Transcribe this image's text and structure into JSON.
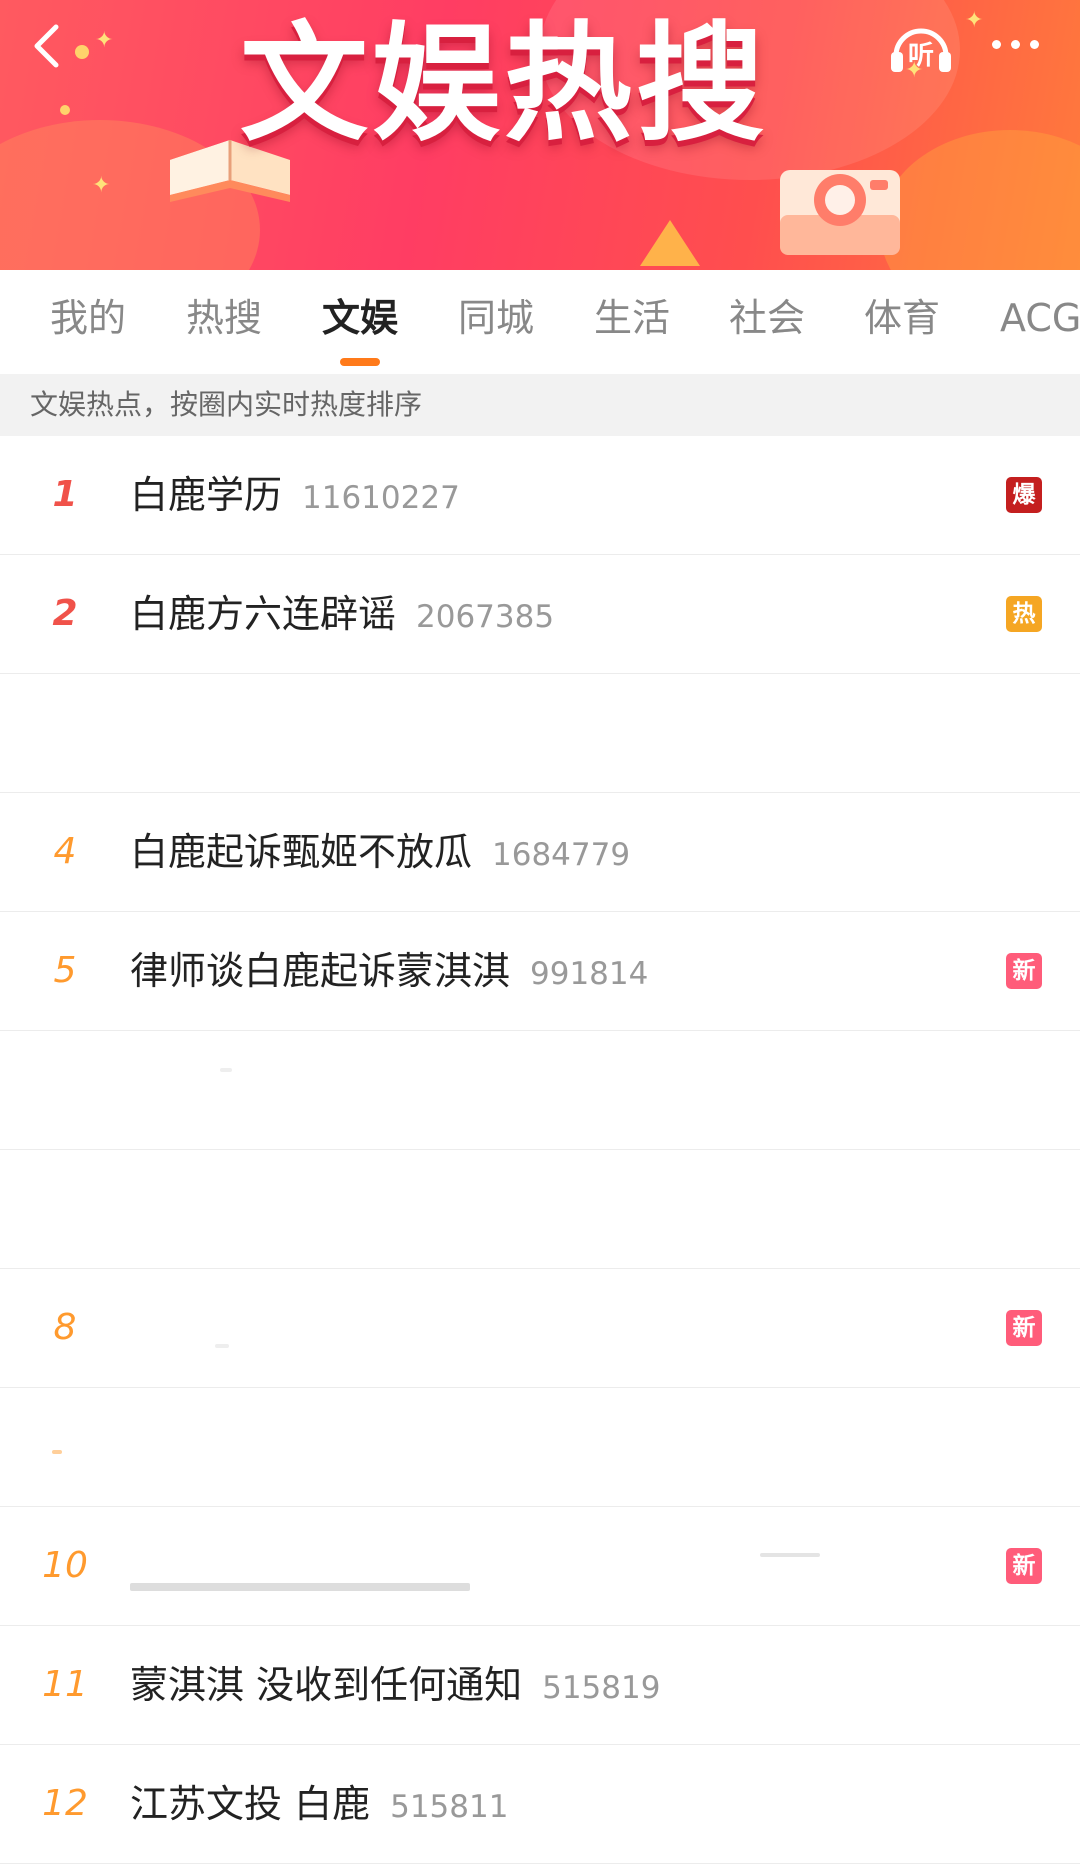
{
  "header": {
    "title": "文娱热搜",
    "listen_label": "听"
  },
  "tabs": [
    {
      "label": "我的",
      "active": false
    },
    {
      "label": "热搜",
      "active": false
    },
    {
      "label": "文娱",
      "active": true
    },
    {
      "label": "同城",
      "active": false
    },
    {
      "label": "生活",
      "active": false
    },
    {
      "label": "社会",
      "active": false
    },
    {
      "label": "体育",
      "active": false
    },
    {
      "label": "ACG",
      "active": false
    }
  ],
  "notice": "文娱热点，按圈内实时热度排序",
  "list": [
    {
      "rank": "1",
      "topic": "白鹿学历",
      "count": "11610227",
      "badge": "爆"
    },
    {
      "rank": "2",
      "topic": "白鹿方六连辟谣",
      "count": "2067385",
      "badge": "热"
    },
    {
      "rank": "",
      "topic": "",
      "count": "",
      "badge": ""
    },
    {
      "rank": "4",
      "topic": "白鹿起诉甄姬不放瓜",
      "count": "1684779",
      "badge": ""
    },
    {
      "rank": "5",
      "topic": "律师谈白鹿起诉蒙淇淇",
      "count": "991814",
      "badge": "新"
    },
    {
      "rank": "",
      "topic": "",
      "count": "",
      "badge": ""
    },
    {
      "rank": "",
      "topic": "",
      "count": "",
      "badge": ""
    },
    {
      "rank": "8",
      "topic": "",
      "count": "",
      "badge": "新"
    },
    {
      "rank": "",
      "topic": "",
      "count": "",
      "badge": ""
    },
    {
      "rank": "10",
      "topic": "",
      "count": "",
      "badge": "新"
    },
    {
      "rank": "11",
      "topic": "蒙淇淇 没收到任何通知",
      "count": "515819",
      "badge": ""
    },
    {
      "rank": "12",
      "topic": "江苏文投 白鹿",
      "count": "515811",
      "badge": ""
    }
  ],
  "colors": {
    "tab_underline": "#ff7a1a",
    "rank_top": "#f0524a",
    "rank_other": "#ff9a2e",
    "badge_boom": "#c41f1f",
    "badge_hot": "#f5a623",
    "badge_new": "#ff5c7a"
  },
  "icons": {
    "back": "chevron-left-icon",
    "listen": "headphones-icon",
    "more": "more-dots-icon"
  }
}
